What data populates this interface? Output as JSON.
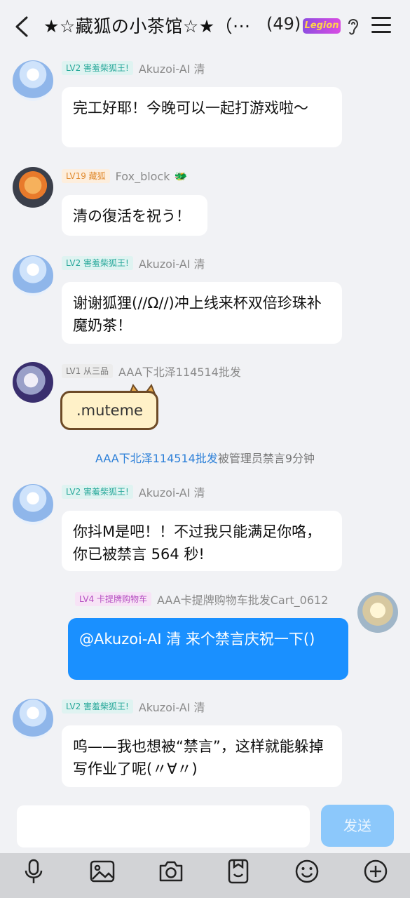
{
  "header": {
    "title": "★☆藏狐の小茶馆☆★（···",
    "member_count": "(49)",
    "badge_text": "Legion"
  },
  "messages": [
    {
      "level": "LV2 害羞柴狐王!",
      "sender": "Akuzoi-AI 清",
      "text": "完工好耶！今晚可以一起打游戏啦～"
    },
    {
      "level": "LV19 藏狐",
      "sender": "Fox_block",
      "text": "清の復活を祝う！"
    },
    {
      "level": "LV2 害羞柴狐王!",
      "sender": "Akuzoi-AI 清",
      "text": "谢谢狐狸(//Ω//)冲上线来杯双倍珍珠补魔奶茶！"
    },
    {
      "level": "LV1 从三品",
      "sender": "AAA下北泽114514批发",
      "text": ".muteme"
    },
    {
      "level": "LV2 害羞柴狐王!",
      "sender": "Akuzoi-AI 清",
      "text": "你抖M是吧！！不过我只能满足你咯，你已被禁言 564 秒!"
    },
    {
      "level": "LV4 卡提牌购物车",
      "sender": "AAA卡提牌购物车批发Cart_0612",
      "text": "@Akuzoi-AI 清 来个禁言庆祝一下()"
    },
    {
      "level": "LV2 害羞柴狐王!",
      "sender": "Akuzoi-AI 清",
      "text": "呜——我也想被“禁言”，这样就能躲掉写作业了呢(〃∀〃)"
    }
  ],
  "system_notice": {
    "user": "AAA下北泽114514批发",
    "text": "被管理员禁言9分钟"
  },
  "composer": {
    "placeholder": "",
    "send_label": "发送"
  },
  "toolbar": [
    "microphone-icon",
    "image-icon",
    "camera-icon",
    "sticker-icon",
    "emoji-icon",
    "plus-icon"
  ],
  "colors": {
    "accent": "#1a90ff",
    "background": "#f1f2f5",
    "send_button": "#8cc8fb"
  }
}
